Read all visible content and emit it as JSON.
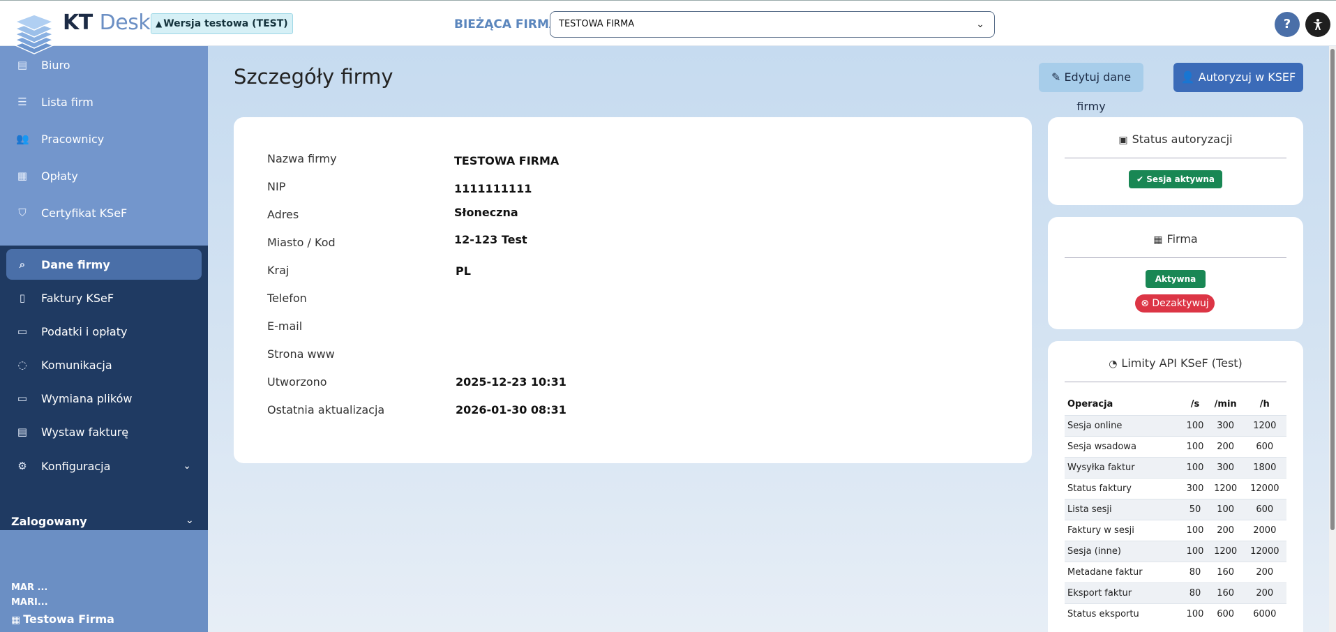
{
  "header": {
    "brand_kt": "KT",
    "brand_desk": "Desk",
    "test_badge": "Wersja testowa (TEST)",
    "company_label": "BIEŻĄCA FIRMA:",
    "company_value": "TESTOWA FIRMA",
    "help_label": "?"
  },
  "sidebar": {
    "items": [
      {
        "label": "Biuro",
        "icon": "building-icon"
      },
      {
        "label": "Lista firm",
        "icon": "list-icon"
      },
      {
        "label": "Pracownicy",
        "icon": "users-icon"
      },
      {
        "label": "Opłaty",
        "icon": "receipt-icon"
      },
      {
        "label": "Certyfikat KSeF",
        "icon": "shield-icon"
      },
      {
        "label": "Dane firmy",
        "icon": "search-icon"
      },
      {
        "label": "Faktury KSeF",
        "icon": "document-icon"
      },
      {
        "label": "Podatki i opłaty",
        "icon": "cash-icon"
      },
      {
        "label": "Komunikacja",
        "icon": "chat-icon"
      },
      {
        "label": "Wymiana plików",
        "icon": "folder-icon"
      },
      {
        "label": "Wystaw fakturę",
        "icon": "invoice-icon"
      },
      {
        "label": "Konfiguracja",
        "icon": "gear-icon"
      }
    ],
    "active": "Dane firmy",
    "logged_label": "Zalogowany",
    "user_line1": "MAR ...",
    "user_line2": "MARI...",
    "firm_name": "Testowa Firma"
  },
  "main": {
    "title": "Szczegóły firmy",
    "edit_button": "Edytuj dane firmy",
    "auth_button": "Autoryzuj w KSEF",
    "details": {
      "company_name_label": "Nazwa firmy",
      "company_name": "TESTOWA FIRMA",
      "nip_label": "NIP",
      "nip": "1111111111",
      "address_label": "Adres",
      "address": "Słoneczna",
      "city_label": "Miasto / Kod",
      "city": "12-123 Test",
      "country_label": "Kraj",
      "country": "PL",
      "phone_label": "Telefon",
      "email_label": "E-mail",
      "www_label": "Strona www",
      "created_label": "Utworzono",
      "created": "2025-12-23 10:31",
      "updated_label": "Ostatnia aktualizacja",
      "updated": "2026-01-30 08:31"
    }
  },
  "auth_card": {
    "title": "Status autoryzacji",
    "badge": "Sesja aktywna"
  },
  "firm_card": {
    "title": "Firma",
    "status": "Aktywna",
    "deactivate": "Dezaktywuj"
  },
  "limits_card": {
    "title": "Limity API KSeF (Test)",
    "headers": [
      "Operacja",
      "/s",
      "/min",
      "/h"
    ],
    "rows": [
      [
        "Sesja online",
        "100",
        "300",
        "1200"
      ],
      [
        "Sesja wsadowa",
        "100",
        "200",
        "600"
      ],
      [
        "Wysyłka faktur",
        "100",
        "300",
        "1800"
      ],
      [
        "Status faktury",
        "300",
        "1200",
        "12000"
      ],
      [
        "Lista sesji",
        "50",
        "100",
        "600"
      ],
      [
        "Faktury w sesji",
        "100",
        "200",
        "2000"
      ],
      [
        "Sesja (inne)",
        "100",
        "1200",
        "12000"
      ],
      [
        "Metadane faktur",
        "80",
        "160",
        "200"
      ],
      [
        "Eksport faktur",
        "80",
        "160",
        "200"
      ],
      [
        "Status eksportu",
        "100",
        "600",
        "6000"
      ]
    ]
  },
  "colors": {
    "sidebar_light": "#7396cc",
    "sidebar_dark": "#1f3a62",
    "accent": "#3b6bb8",
    "success": "#198754",
    "danger": "#dc3545"
  }
}
